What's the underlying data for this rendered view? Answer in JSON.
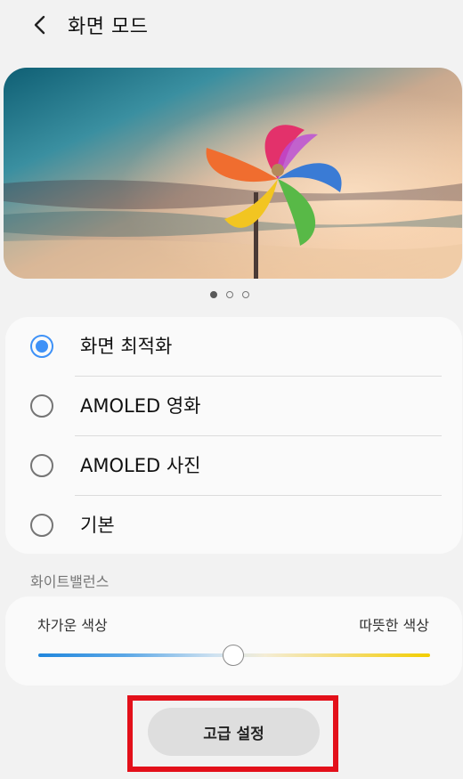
{
  "header": {
    "title": "화면 모드",
    "back_icon": "chevron-left-icon"
  },
  "preview": {
    "subject": "pinwheel",
    "page_count": 3,
    "active_page": 1
  },
  "screen_modes": {
    "options": [
      {
        "label": "화면 최적화",
        "selected": true
      },
      {
        "label": "AMOLED 영화",
        "selected": false
      },
      {
        "label": "AMOLED 사진",
        "selected": false
      },
      {
        "label": "기본",
        "selected": false
      }
    ]
  },
  "white_balance": {
    "section_title": "화이트밸런스",
    "cool_label": "차가운 색상",
    "warm_label": "따뜻한 색상",
    "value": 0.5
  },
  "advanced_button": {
    "label": "고급 설정"
  },
  "colors": {
    "accent": "#3e91f7",
    "background": "#f2f2f2",
    "card": "#fafafa",
    "highlight": "#e3101a"
  }
}
